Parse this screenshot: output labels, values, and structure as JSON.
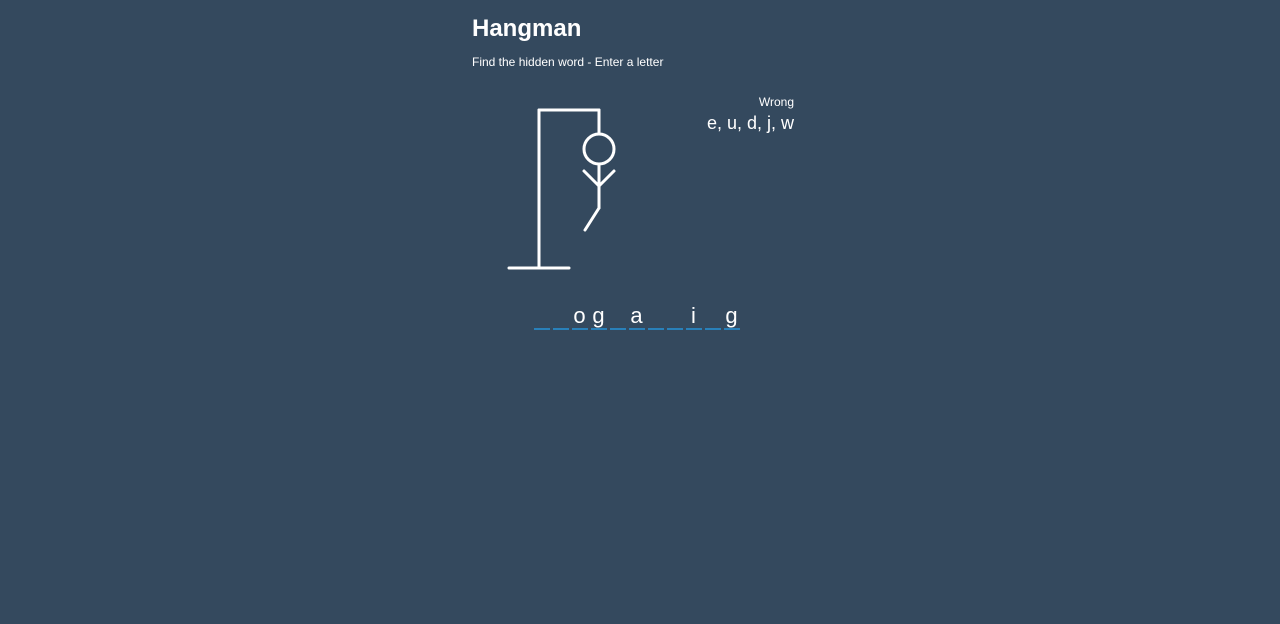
{
  "header": {
    "title": "Hangman",
    "subtitle": "Find the hidden word - Enter a letter"
  },
  "wrong": {
    "label": "Wrong",
    "letters": "e, u, d, j, w"
  },
  "word": {
    "letters": [
      "",
      "",
      "o",
      "g",
      "",
      "a",
      "",
      "",
      "i",
      "",
      "g"
    ]
  },
  "figure": {
    "parts_shown": [
      "head",
      "body",
      "left-arm",
      "right-arm",
      "left-leg"
    ]
  },
  "colors": {
    "background": "#34495e",
    "underline": "#2980b9",
    "text": "#ffffff"
  }
}
